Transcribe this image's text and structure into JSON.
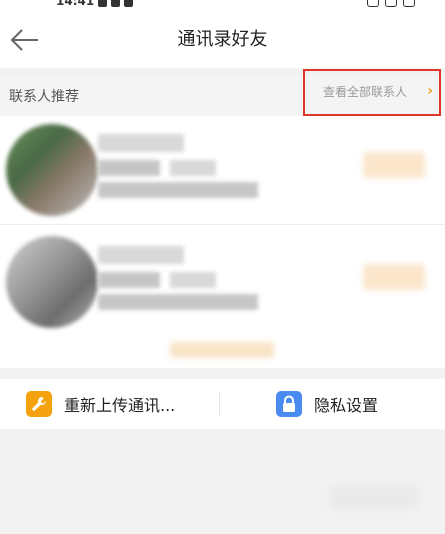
{
  "status_bar": {
    "time": "14:41"
  },
  "nav": {
    "title": "通讯录好友"
  },
  "section": {
    "title": "联系人推荐",
    "view_all_label": "查看全部联系人",
    "chevron": "›"
  },
  "actions": {
    "reupload_label": "重新上传通讯...",
    "privacy_label": "隐私设置"
  },
  "colors": {
    "highlight_border": "#e0352b",
    "wrench_icon_bg": "#f5a20f",
    "lock_icon_bg": "#4a8bf0",
    "chevron": "#f0a020"
  },
  "icons": [
    "back-arrow-icon",
    "chevron-right-icon",
    "wrench-icon",
    "lock-icon"
  ]
}
